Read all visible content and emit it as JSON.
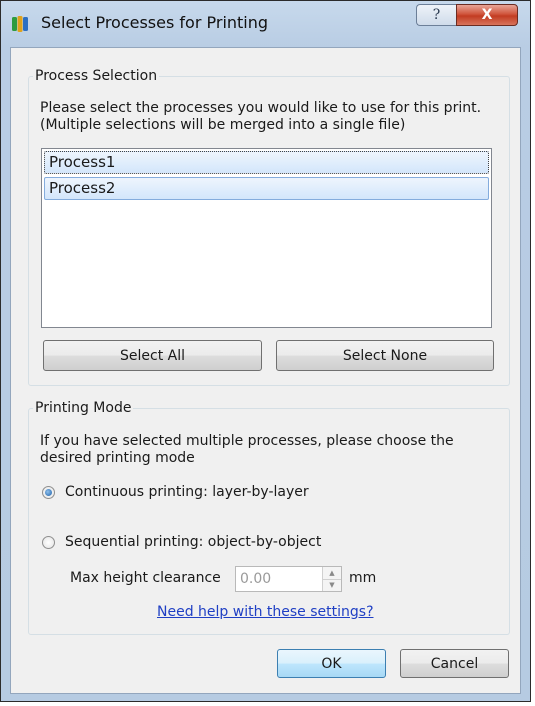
{
  "window": {
    "title": "Select Processes for Printing",
    "help_glyph": "?",
    "close_glyph": "X"
  },
  "process_selection": {
    "legend": "Process Selection",
    "description_line1": "Please select the processes you would like to use for this print.",
    "description_line2": "(Multiple selections will be merged into a single file)",
    "items": [
      "Process1",
      "Process2"
    ],
    "select_all_label": "Select All",
    "select_none_label": "Select None"
  },
  "printing_mode": {
    "legend": "Printing Mode",
    "description_line1": "If you have selected multiple processes, please choose the",
    "description_line2": "desired printing mode",
    "options": [
      {
        "label": "Continuous printing: layer-by-layer",
        "selected": true
      },
      {
        "label": "Sequential printing: object-by-object",
        "selected": false
      }
    ],
    "max_height_label": "Max height clearance",
    "max_height_value": "0.00",
    "unit": "mm",
    "help_link": "Need help with these settings?"
  },
  "buttons": {
    "ok_label": "OK",
    "cancel_label": "Cancel"
  },
  "icons": {
    "app": "app-process-icon",
    "help": "help-icon",
    "close": "close-icon",
    "spin_up": "spin-up-icon",
    "spin_down": "spin-down-icon"
  },
  "colors": {
    "selection_fill": "#d3e6fb",
    "selection_border": "#84acdd",
    "link": "#1f3fc4",
    "close_button": "#c23c22"
  }
}
